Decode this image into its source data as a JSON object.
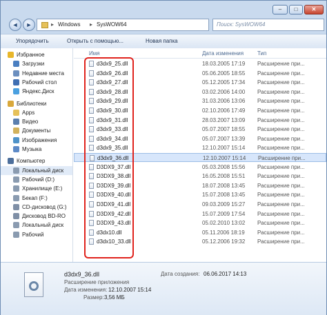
{
  "address": {
    "segment1": "Windows",
    "segment2": "SysWOW64",
    "sep": "▸",
    "search_placeholder": "Поиск: SysWOW64"
  },
  "toolbar": {
    "organize": "Упорядочить",
    "share": "Открыть с помощью...",
    "new_folder": "Новая папка"
  },
  "columns": {
    "name": "Имя",
    "date": "Дата изменения",
    "type": "Тип"
  },
  "nav": [
    {
      "label": "Избранное",
      "icon": "star-icon",
      "color": "#e8b62a",
      "header": true
    },
    {
      "label": "Загрузки",
      "icon": "downloads-icon",
      "color": "#4a7fc1"
    },
    {
      "label": "Недавние места",
      "icon": "recent-places-icon",
      "color": "#6c8fbf"
    },
    {
      "label": "Рабочий стол",
      "icon": "desktop-icon",
      "color": "#3f6fb3"
    },
    {
      "label": "Яндекс.Диск",
      "icon": "cloud-icon",
      "color": "#4aa0e0"
    },
    {
      "label": "Библиотеки",
      "icon": "library-icon",
      "color": "#d9a83b",
      "header": true
    },
    {
      "label": "Apps",
      "icon": "folder-icon",
      "color": "#e6c15a"
    },
    {
      "label": "Видео",
      "icon": "video-icon",
      "color": "#5b7fae"
    },
    {
      "label": "Документы",
      "icon": "documents-icon",
      "color": "#d2b25c"
    },
    {
      "label": "Изображения",
      "icon": "pictures-icon",
      "color": "#4f93c9"
    },
    {
      "label": "Музыка",
      "icon": "music-icon",
      "color": "#5d8ac7"
    },
    {
      "label": "Компьютер",
      "icon": "computer-icon",
      "color": "#4d6f9c",
      "header": true
    },
    {
      "label": "Локальный диск",
      "icon": "drive-icon",
      "color": "#8a9bb0",
      "selected": true
    },
    {
      "label": "Рабочий (D:)",
      "icon": "drive-icon",
      "color": "#8a9bb0"
    },
    {
      "label": "Хранилище (E:)",
      "icon": "drive-icon",
      "color": "#8a9bb0"
    },
    {
      "label": "Бекап (F:)",
      "icon": "drive-icon",
      "color": "#8a9bb0"
    },
    {
      "label": "CD-дисковод (G:)",
      "icon": "cd-drive-icon",
      "color": "#7f8fa6"
    },
    {
      "label": "Дисковод BD-RO",
      "icon": "cd-drive-icon",
      "color": "#7f8fa6"
    },
    {
      "label": "Локальный диск",
      "icon": "drive-icon",
      "color": "#8a9bb0"
    },
    {
      "label": "Рабочий",
      "icon": "drive-icon",
      "color": "#8a9bb0"
    }
  ],
  "files": [
    {
      "name": "d3dx9_25.dll",
      "date": "18.03.2005 17:19",
      "type": "Расширение при..."
    },
    {
      "name": "d3dx9_26.dll",
      "date": "05.06.2005 18:55",
      "type": "Расширение при..."
    },
    {
      "name": "d3dx9_27.dll",
      "date": "05.12.2005 17:34",
      "type": "Расширение при..."
    },
    {
      "name": "d3dx9_28.dll",
      "date": "03.02.2006 14:00",
      "type": "Расширение при..."
    },
    {
      "name": "d3dx9_29.dll",
      "date": "31.03.2006 13:06",
      "type": "Расширение при..."
    },
    {
      "name": "d3dx9_30.dll",
      "date": "02.10.2006 17:49",
      "type": "Расширение при..."
    },
    {
      "name": "d3dx9_31.dll",
      "date": "28.03.2007 13:09",
      "type": "Расширение при..."
    },
    {
      "name": "d3dx9_33.dll",
      "date": "05.07.2007 18:55",
      "type": "Расширение при..."
    },
    {
      "name": "d3dx9_34.dll",
      "date": "05.07.2007 13:39",
      "type": "Расширение при..."
    },
    {
      "name": "d3dx9_35.dll",
      "date": "12.10.2007 15:14",
      "type": "Расширение при..."
    },
    {
      "name": "d3dx9_36.dll",
      "date": "12.10.2007 15:14",
      "type": "Расширение при...",
      "selected": true
    },
    {
      "name": "D3DX9_37.dll",
      "date": "05.03.2008 15:56",
      "type": "Расширение при..."
    },
    {
      "name": "D3DX9_38.dll",
      "date": "16.05.2008 15:51",
      "type": "Расширение при..."
    },
    {
      "name": "D3DX9_39.dll",
      "date": "18.07.2008 13:45",
      "type": "Расширение при..."
    },
    {
      "name": "D3DX9_40.dll",
      "date": "15.07.2008 13:45",
      "type": "Расширение при..."
    },
    {
      "name": "D3DX9_41.dll",
      "date": "09.03.2009 15:27",
      "type": "Расширение при..."
    },
    {
      "name": "D3DX9_42.dll",
      "date": "15.07.2009 17:54",
      "type": "Расширение при..."
    },
    {
      "name": "D3DX9_43.dll",
      "date": "05.02.2010 13:02",
      "type": "Расширение при..."
    },
    {
      "name": "d3dx10.dll",
      "date": "05.11.2006 18:19",
      "type": "Расширение при..."
    },
    {
      "name": "d3dx10_33.dll",
      "date": "05.12.2006 19:32",
      "type": "Расширение при..."
    }
  ],
  "details": {
    "filename": "d3dx9_36.dll",
    "type": "Расширение приложения",
    "modified_label": "Дата изменения:",
    "modified": "12.10.2007 15:14",
    "created_label": "Дата создания:",
    "created": "06.06.2017 14:13",
    "size_label": "Размер:",
    "size": "3,56 МБ"
  },
  "window_controls": {
    "minimize": "–",
    "maximize": "□",
    "close": "✕"
  },
  "nav_buttons": {
    "back": "◄",
    "forward": "►"
  }
}
